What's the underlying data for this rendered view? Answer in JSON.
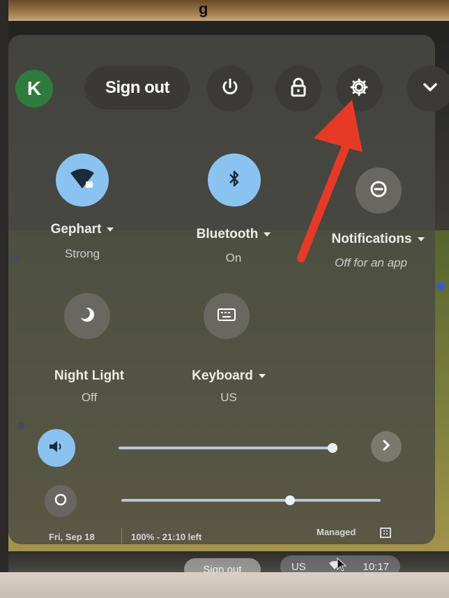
{
  "photo": {
    "top_text": "g"
  },
  "user": {
    "avatar_initial": "K",
    "sign_out_label": "Sign out"
  },
  "top_buttons": {
    "power_icon": "power-icon",
    "lock_icon": "lock-icon",
    "settings_icon": "gear-icon",
    "collapse_icon": "chevron-down-icon"
  },
  "tiles": [
    {
      "label": "Gephart",
      "sub": "Strong",
      "icon": "wifi-icon",
      "active": true
    },
    {
      "label": "Bluetooth",
      "sub": "On",
      "icon": "bluetooth-icon",
      "active": true
    },
    {
      "label": "Notifications",
      "sub": "Off for an app",
      "icon": "do-not-disturb-icon",
      "active": false
    },
    {
      "label": "Night Light",
      "sub": "Off",
      "icon": "night-light-icon",
      "active": false
    },
    {
      "label": "Keyboard",
      "sub": "US",
      "icon": "keyboard-icon",
      "active": false
    }
  ],
  "sliders": {
    "volume_fraction": 0.99,
    "brightness_fraction": 0.65
  },
  "footer": {
    "date": "Fri, Sep 18",
    "battery": "100% - 21:10 left",
    "managed": "Managed"
  },
  "shelf": {
    "sign_out_label": "Sign out",
    "region": "US",
    "time": "10:17"
  },
  "colors": {
    "accent_blue": "#8bc3f0",
    "annotation_red": "#e63a26",
    "avatar_green": "#2f7a3d"
  }
}
